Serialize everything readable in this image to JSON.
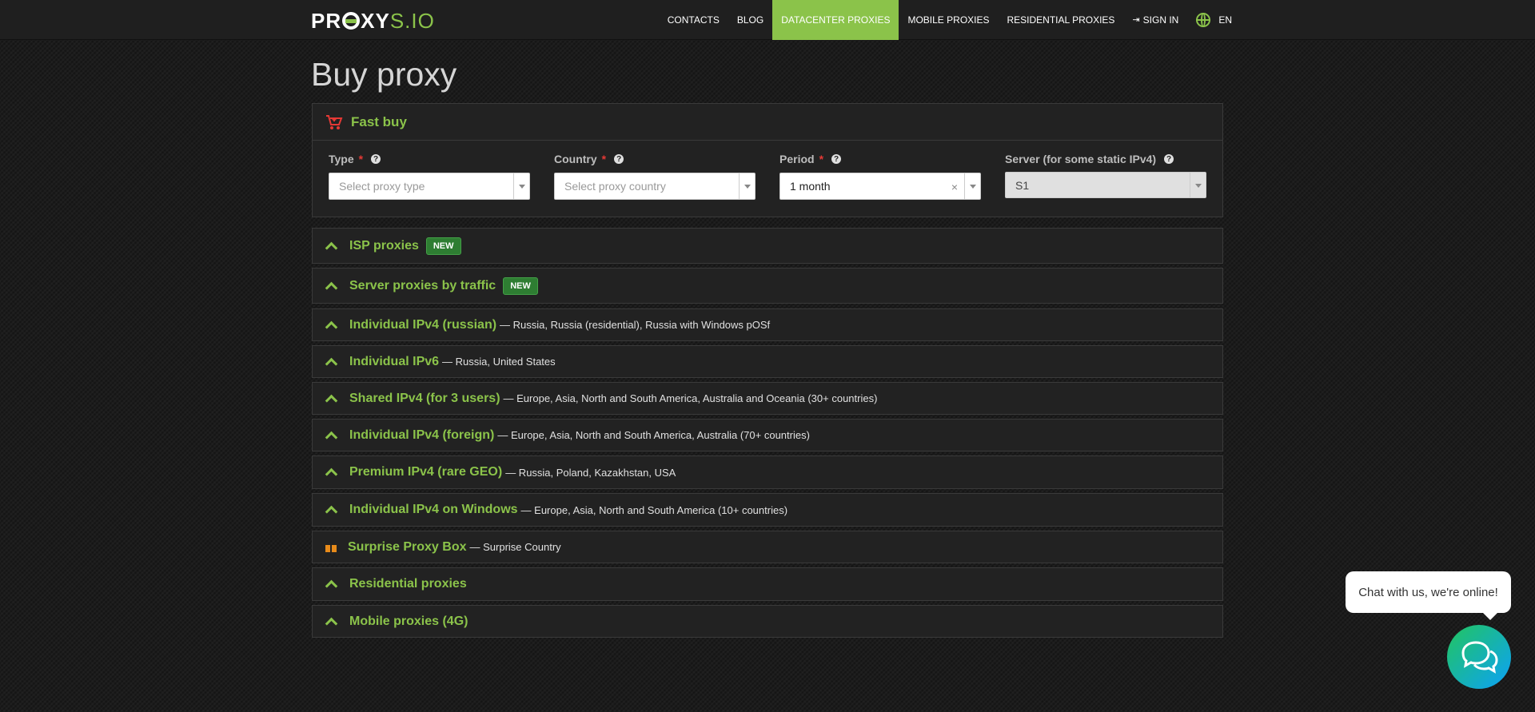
{
  "brand": {
    "logo_bold_left": "PR",
    "logo_bold_right": "XY",
    "logo_thin": "S.IO",
    "logo_text": "PROXYS.IO"
  },
  "nav": {
    "items": [
      {
        "label": "CONTACTS",
        "active": false
      },
      {
        "label": "BLOG",
        "active": false
      },
      {
        "label": "DATACENTER PROXIES",
        "active": true
      },
      {
        "label": "MOBILE PROXIES",
        "active": false
      },
      {
        "label": "RESIDENTIAL PROXIES",
        "active": false
      }
    ],
    "signin_label": "SIGN IN",
    "language_label": "EN"
  },
  "page": {
    "title": "Buy proxy"
  },
  "fast_buy": {
    "title": "Fast buy",
    "fields": {
      "type": {
        "label": "Type",
        "required_mark": "*",
        "placeholder": "Select proxy type"
      },
      "country": {
        "label": "Country",
        "required_mark": "*",
        "placeholder": "Select proxy country"
      },
      "period": {
        "label": "Period",
        "required_mark": "*",
        "value": "1 month",
        "clear": "×"
      },
      "server": {
        "label": "Server (for some static IPv4)",
        "value": "S1"
      }
    },
    "help_glyph": "?"
  },
  "sections": [
    {
      "title": "ISP proxies",
      "badge": "NEW",
      "desc": ""
    },
    {
      "title": "Server proxies by traffic",
      "badge": "NEW",
      "desc": ""
    },
    {
      "title": "Individual IPv4 (russian)",
      "badge": "",
      "desc": "— Russia, Russia (residential), Russia with Windows pOSf"
    },
    {
      "title": "Individual IPv6",
      "badge": "",
      "desc": "— Russia, United States"
    },
    {
      "title": "Shared IPv4 (for 3 users)",
      "badge": "",
      "desc": "— Europe, Asia, North and South America, Australia and Oceania (30+ countries)"
    },
    {
      "title": "Individual IPv4 (foreign)",
      "badge": "",
      "desc": "— Europe, Asia, North and South America, Australia (70+ countries)"
    },
    {
      "title": "Premium IPv4 (rare GEO)",
      "badge": "",
      "desc": "— Russia, Poland, Kazakhstan, USA"
    },
    {
      "title": "Individual IPv4 on Windows",
      "badge": "",
      "desc": "— Europe, Asia, North and South America (10+ countries)"
    },
    {
      "title": "Surprise Proxy Box",
      "badge": "",
      "desc": "— Surprise Country",
      "icon": "gift-icon"
    },
    {
      "title": "Residential proxies",
      "badge": "",
      "desc": ""
    },
    {
      "title": "Mobile proxies (4G)",
      "badge": "",
      "desc": ""
    }
  ],
  "chat": {
    "message": "Chat with us, we're online!"
  },
  "colors": {
    "accent": "#8bc34a",
    "badge": "#2e7d32",
    "required": "#e53935",
    "gift": "#e88b1a"
  }
}
